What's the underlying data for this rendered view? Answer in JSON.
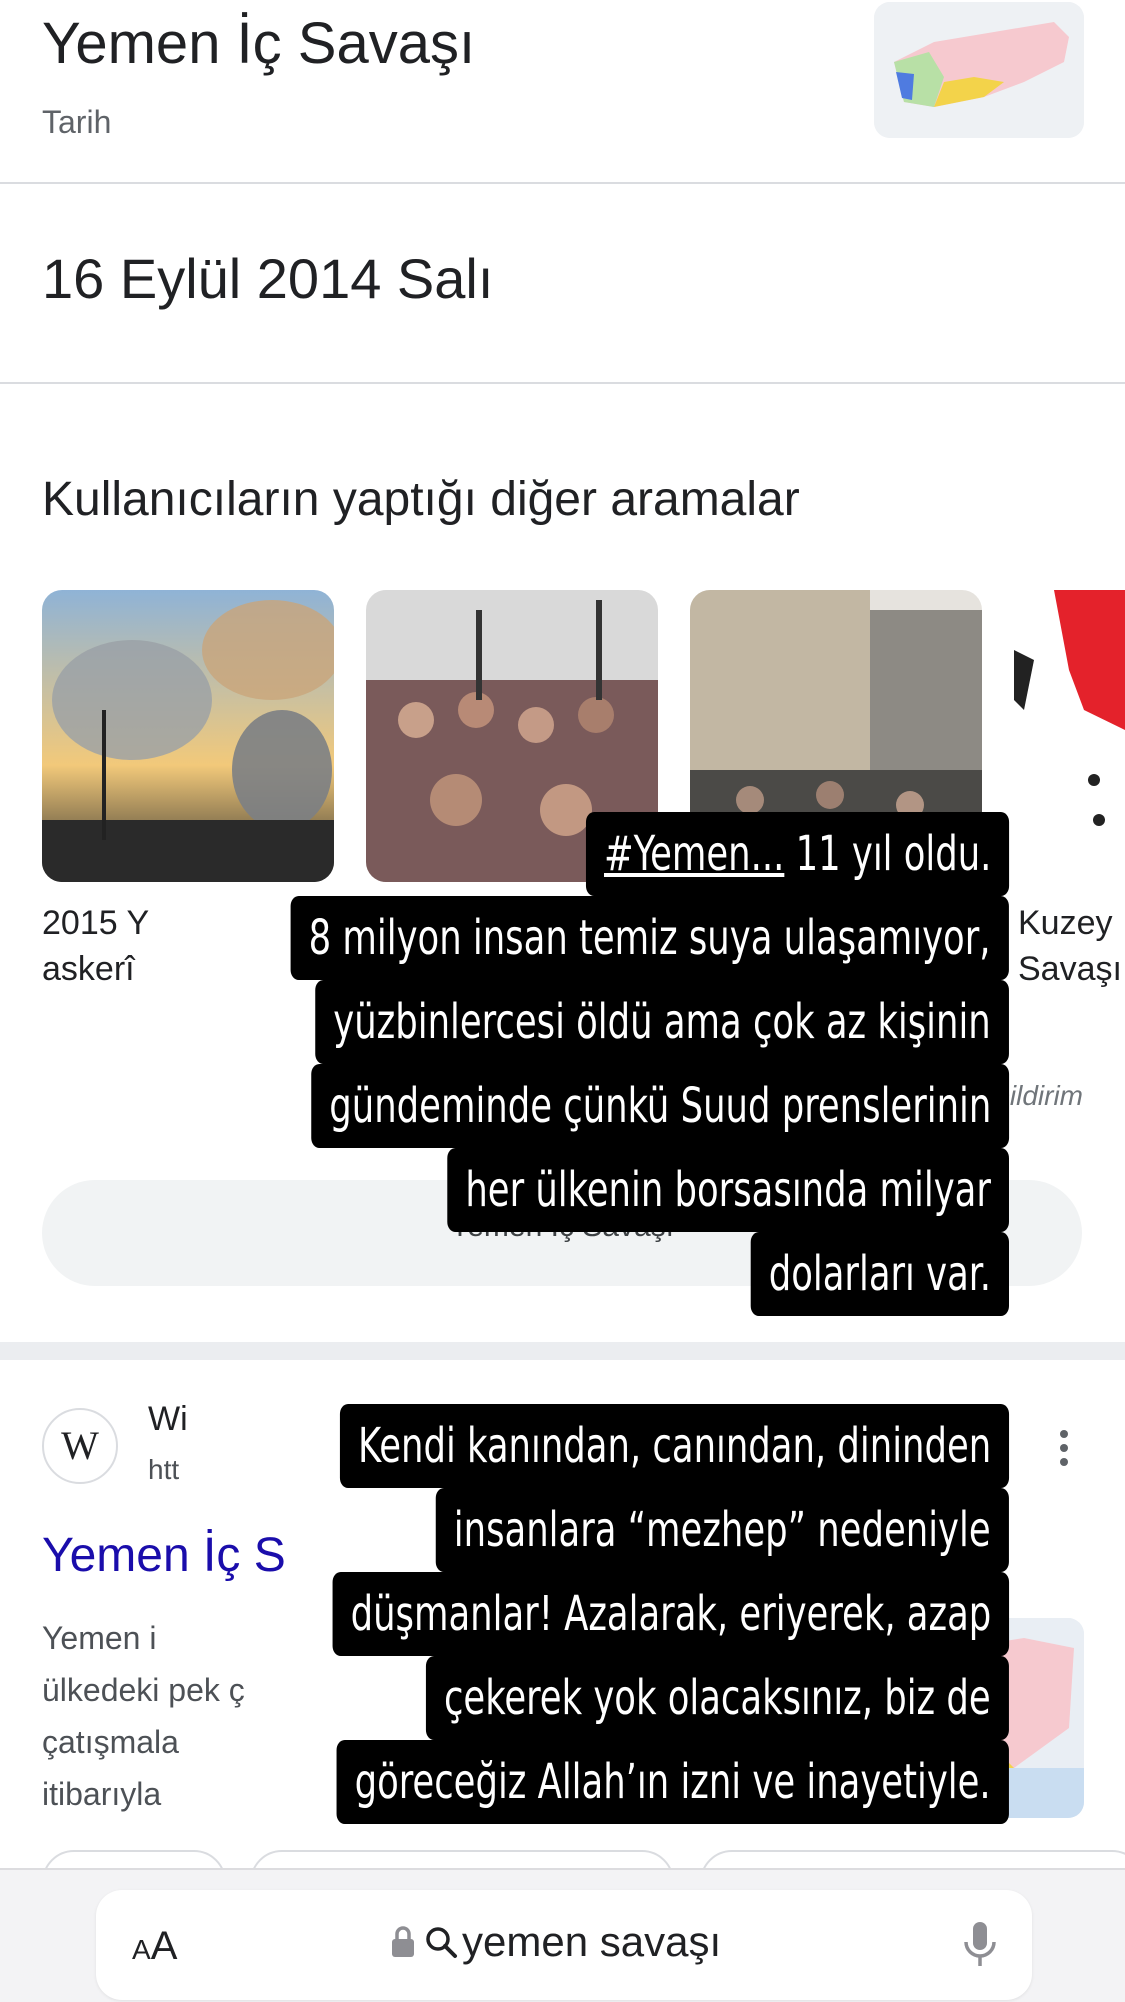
{
  "header": {
    "title": "Yemen İç Savaşı",
    "subtitle": "Tarih"
  },
  "date_card": {
    "value": "16 Eylül 2014 Salı"
  },
  "related_searches": {
    "title": "Kullanıcıların yaptığı diğer aramalar",
    "cards": [
      {
        "label_line1": "2015 Y",
        "label_line2": "askerî"
      },
      {
        "label_line1": "",
        "label_line2": ""
      },
      {
        "label_line1": "",
        "label_line2": ""
      },
      {
        "label_line1": "Kuzey",
        "label_line2": "Savaşı"
      }
    ],
    "feedback": "bildirim",
    "pill_text": "Yemen İç Savaşı"
  },
  "result": {
    "site_name": "Wi",
    "url": "htt",
    "title": "Yemen İç S",
    "snippet": [
      "Yemen i",
      "ülkedeki pek ç",
      "çatışmala",
      "itibarıyla"
    ]
  },
  "overlay_top": {
    "hashtag": "#Yemen...",
    "lines": [
      " 11 yıl oldu.",
      "8 milyon insan temiz suya ulaşamıyor,",
      "yüzbinlercesi öldü ama çok az kişinin",
      "gündeminde çünkü Suud prenslerinin",
      "her ülkenin borsasında milyar",
      "dolarları var."
    ]
  },
  "overlay_bottom": {
    "lines": [
      "Kendi kanından, canından, dininden",
      "insanlara “mezhep” nedeniyle",
      "düşmanlar! Azalarak, eriyerek, azap",
      "çekerek yok olacaksınız, biz de",
      "göreceğiz Allah’ın izni ve inayetiyle."
    ]
  },
  "browser_bar": {
    "text_size_label": "AA",
    "url_text": "yemen savaşı",
    "lock_icon": "lock-icon",
    "search_icon": "search-icon",
    "mic_icon": "mic-icon"
  }
}
